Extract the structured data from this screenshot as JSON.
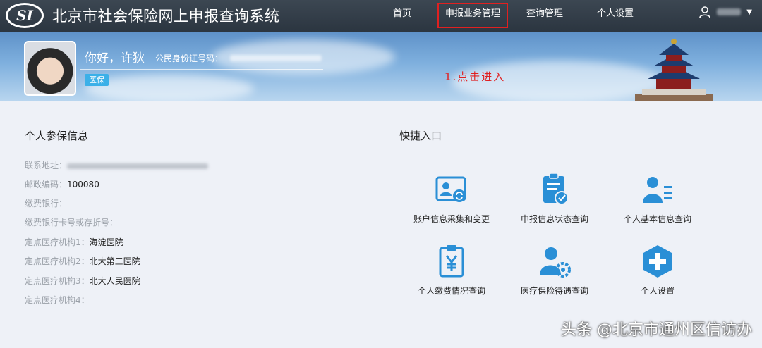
{
  "header": {
    "logo_text": "SI",
    "title": "北京市社会保险网上申报查询系统",
    "nav": [
      "首页",
      "申报业务管理",
      "查询管理",
      "个人设置"
    ],
    "user_icon": "user-icon",
    "caret": "▼"
  },
  "banner": {
    "greeting": "你好，许狄",
    "id_label": "公民身份证号码：",
    "badge": "医保",
    "step_note": "1.点击进入"
  },
  "personal": {
    "title": "个人参保信息",
    "rows": [
      {
        "label": "联系地址：",
        "value": ""
      },
      {
        "label": "邮政编码：",
        "value": "100080"
      },
      {
        "label": "缴费银行：",
        "value": ""
      },
      {
        "label": "缴费银行卡号或存折号：",
        "value": ""
      },
      {
        "label": "定点医疗机构1：",
        "value": "海淀医院"
      },
      {
        "label": "定点医疗机构2：",
        "value": "北大第三医院"
      },
      {
        "label": "定点医疗机构3：",
        "value": "北大人民医院"
      },
      {
        "label": "定点医疗机构4：",
        "value": ""
      }
    ]
  },
  "quick": {
    "title": "快捷入口",
    "items": [
      {
        "label": "账户信息采集和变更",
        "icon": "id-card-refresh-icon"
      },
      {
        "label": "申报信息状态查询",
        "icon": "clipboard-check-icon"
      },
      {
        "label": "个人基本信息查询",
        "icon": "user-list-icon"
      },
      {
        "label": "个人缴费情况查询",
        "icon": "clipboard-yen-icon"
      },
      {
        "label": "医疗保险待遇查询",
        "icon": "user-gear-icon"
      },
      {
        "label": "个人设置",
        "icon": "medical-cross-icon"
      }
    ]
  },
  "colors": {
    "accent": "#2a8fd6",
    "highlight": "#e02020",
    "nav_bg": "#333e49"
  },
  "watermark": "头条 @北京市通州区信访办"
}
